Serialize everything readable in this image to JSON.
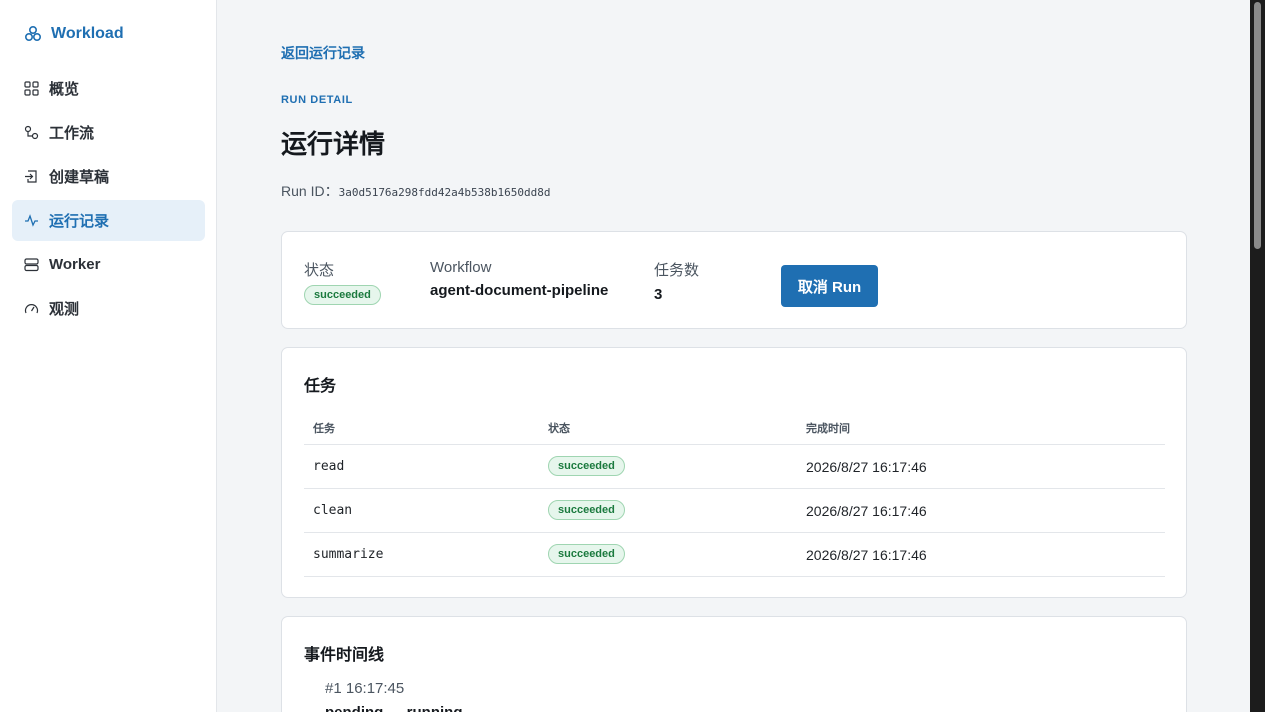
{
  "sidebar": {
    "brand": "Workload",
    "items": [
      {
        "label": "概览",
        "icon": "grid-icon"
      },
      {
        "label": "工作流",
        "icon": "workflow-icon"
      },
      {
        "label": "创建草稿",
        "icon": "draft-icon"
      },
      {
        "label": "运行记录",
        "icon": "activity-icon",
        "active": true
      },
      {
        "label": "Worker",
        "icon": "server-icon"
      },
      {
        "label": "观测",
        "icon": "gauge-icon"
      }
    ]
  },
  "header": {
    "back_link": "返回运行记录",
    "eyebrow": "RUN DETAIL",
    "title": "运行详情",
    "run_id_label": "Run ID：",
    "run_id": "3a0d5176a298fdd42a4b538b1650dd8d"
  },
  "summary": {
    "status_label": "状态",
    "status_value": "succeeded",
    "workflow_label": "Workflow",
    "workflow_value": "agent-document-pipeline",
    "task_count_label": "任务数",
    "task_count_value": "3",
    "cancel_button": "取消 Run"
  },
  "tasks": {
    "title": "任务",
    "columns": [
      "任务",
      "状态",
      "完成时间"
    ],
    "rows": [
      {
        "task": "read",
        "status": "succeeded",
        "completed": "2026/8/27 16:17:46"
      },
      {
        "task": "clean",
        "status": "succeeded",
        "completed": "2026/8/27 16:17:46"
      },
      {
        "task": "summarize",
        "status": "succeeded",
        "completed": "2026/8/27 16:17:46"
      }
    ]
  },
  "events": {
    "title": "事件时间线",
    "items": [
      {
        "header": "#1 16:17:45",
        "transition": "pending → running"
      }
    ]
  },
  "colors": {
    "accent": "#1f6fb2",
    "success_text": "#1b7a3e",
    "success_bg": "#e6f6ec"
  }
}
